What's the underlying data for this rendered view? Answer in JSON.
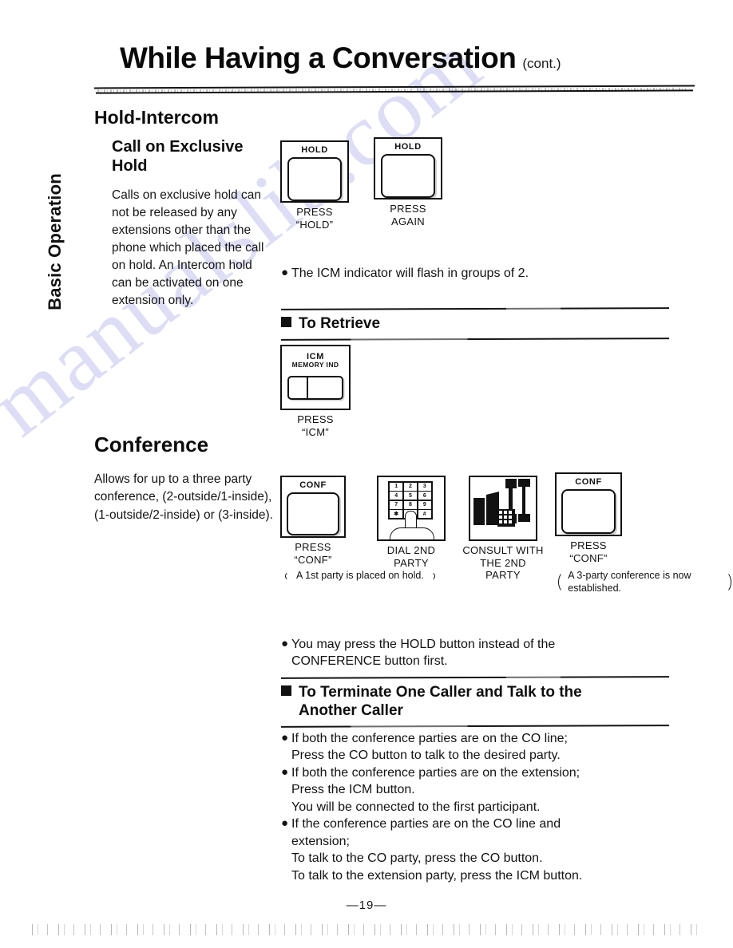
{
  "page": {
    "title": "While Having a Conversation",
    "title_suffix": "(cont.)",
    "side_tab": "Basic Operation",
    "page_number": "—19—",
    "watermark": "manualslib.com"
  },
  "sections": {
    "hold_intercom": {
      "heading": "Hold-Intercom",
      "subheading": "Call on Exclusive Hold",
      "body": "Calls on exclusive hold can not be released by any extensions other than the phone which placed the call on hold. An Intercom hold can be activated on one extension only.",
      "note": "The ICM indicator will flash  in groups of 2.",
      "figures": [
        {
          "button_label": "HOLD",
          "caption_line1": "PRESS",
          "caption_line2": "“HOLD”"
        },
        {
          "button_label": "HOLD",
          "caption_line1": "PRESS",
          "caption_line2": "AGAIN"
        }
      ]
    },
    "to_retrieve": {
      "heading": "To Retrieve",
      "figure": {
        "button_label": "ICM",
        "button_sublabel": "MEMORY IND",
        "caption_line1": "PRESS",
        "caption_line2": "“ICM”"
      }
    },
    "conference": {
      "heading": "Conference",
      "body": "Allows for up to a three party conference, (2-outside/1-inside), (1-outside/2-inside) or (3-inside).",
      "steps": [
        {
          "button_label": "CONF",
          "caption_line1": "PRESS",
          "caption_line2": "“CONF”",
          "note": "A 1st party is placed on hold."
        },
        {
          "caption_line1": "DIAL 2ND PARTY",
          "caption_line2": "",
          "keypad": [
            "1",
            "2",
            "3",
            "4",
            "5",
            "6",
            "7",
            "8",
            "9",
            "✱",
            "0",
            "#"
          ]
        },
        {
          "caption_line1": "CONSULT WITH",
          "caption_line2": "THE 2ND PARTY"
        },
        {
          "button_label": "CONF",
          "caption_line1": "PRESS",
          "caption_line2": "“CONF”",
          "note": "A 3-party conference is now established."
        }
      ],
      "note_line1": "You may press the HOLD button instead of the",
      "note_line2": "CONFERENCE button first."
    },
    "to_terminate": {
      "heading_line1": "To Terminate One Caller and Talk to the",
      "heading_line2": "Another Caller",
      "bullets": [
        {
          "lead": "If both the conference parties are on the  CO line;",
          "continuations": [
            "Press the CO button to talk to the desired party."
          ]
        },
        {
          "lead": "If both the conference parties are on the extension;",
          "continuations": [
            "Press the ICM button.",
            "You will be connected to the first participant."
          ]
        },
        {
          "lead": "If the conference parties are on the CO line and",
          "continuations": [
            "extension;",
            "To talk to the CO party, press the CO button.",
            "To talk to the extension party, press the ICM button."
          ]
        }
      ]
    }
  }
}
